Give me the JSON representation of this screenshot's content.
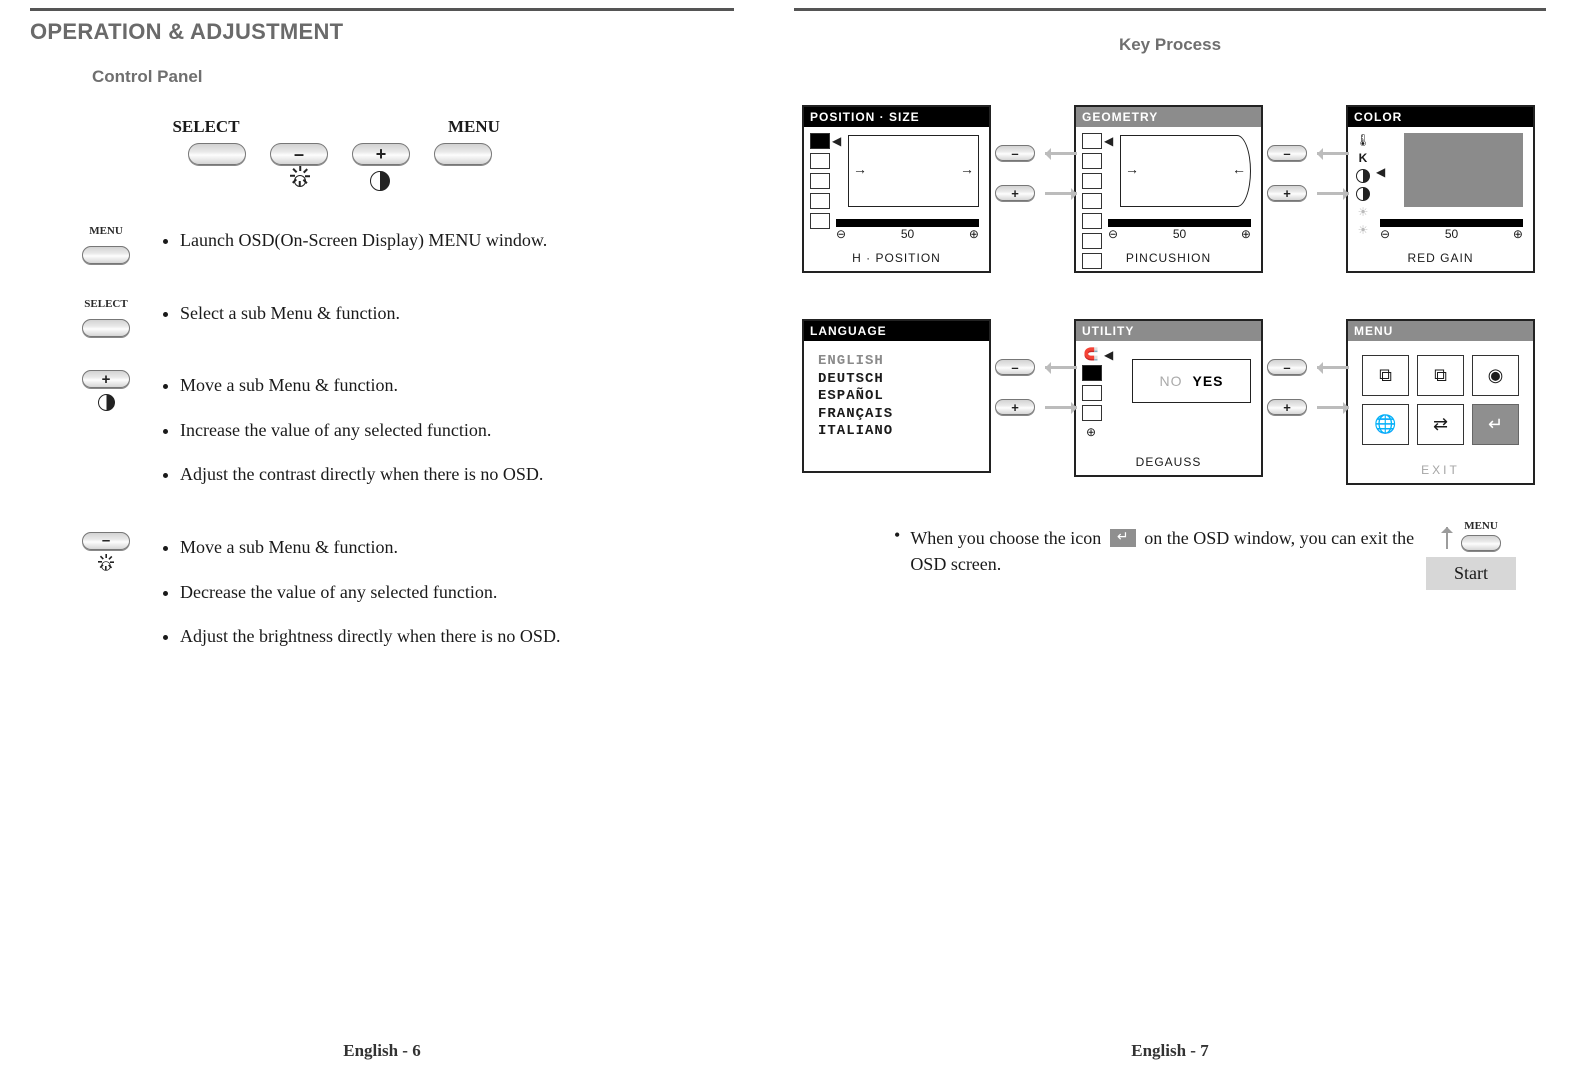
{
  "left": {
    "title": "OPERATION & ADJUSTMENT",
    "subtitle": "Control Panel",
    "buttons": {
      "select": "SELECT",
      "menu": "MENU",
      "plus": "+",
      "minus": "–"
    },
    "desc": {
      "menu_label": "MENU",
      "menu_item": "Launch OSD(On-Screen Display) MENU window.",
      "select_label": "SELECT",
      "select_item": "Select a sub Menu & function.",
      "plus": {
        "a": "Move a sub Menu & function.",
        "b": "Increase the value of any selected function.",
        "c": "Adjust the contrast directly when there is no OSD."
      },
      "minus": {
        "a": "Move a sub Menu & function.",
        "b": "Decrease the value of any selected function.",
        "c": "Adjust the brightness directly when there is no OSD."
      }
    },
    "footer": "English - 6"
  },
  "right": {
    "title": "Key Process",
    "osd": {
      "position": {
        "title": "POSITION · SIZE",
        "caption": "H · POSITION",
        "value": "50"
      },
      "geometry": {
        "title": "GEOMETRY",
        "caption": "PINCUSHION",
        "value": "50"
      },
      "color": {
        "title": "COLOR",
        "caption": "RED GAIN",
        "value": "50",
        "k": "K"
      },
      "language": {
        "title": "LANGUAGE",
        "items": {
          "en": "ENGLISH",
          "de": "DEUTSCH",
          "es": "ESPAÑOL",
          "fr": "FRANÇAIS",
          "it": "ITALIANO"
        }
      },
      "utility": {
        "title": "UTILITY",
        "caption": "DEGAUSS",
        "no": "NO",
        "yes": "YES"
      },
      "menu": {
        "title": "MENU",
        "caption": "EXIT"
      }
    },
    "start": {
      "menu_label": "MENU",
      "label": "Start"
    },
    "note_a": "When you choose the icon",
    "note_b": "on the OSD window, you can exit the OSD screen.",
    "footer": "English - 7"
  }
}
